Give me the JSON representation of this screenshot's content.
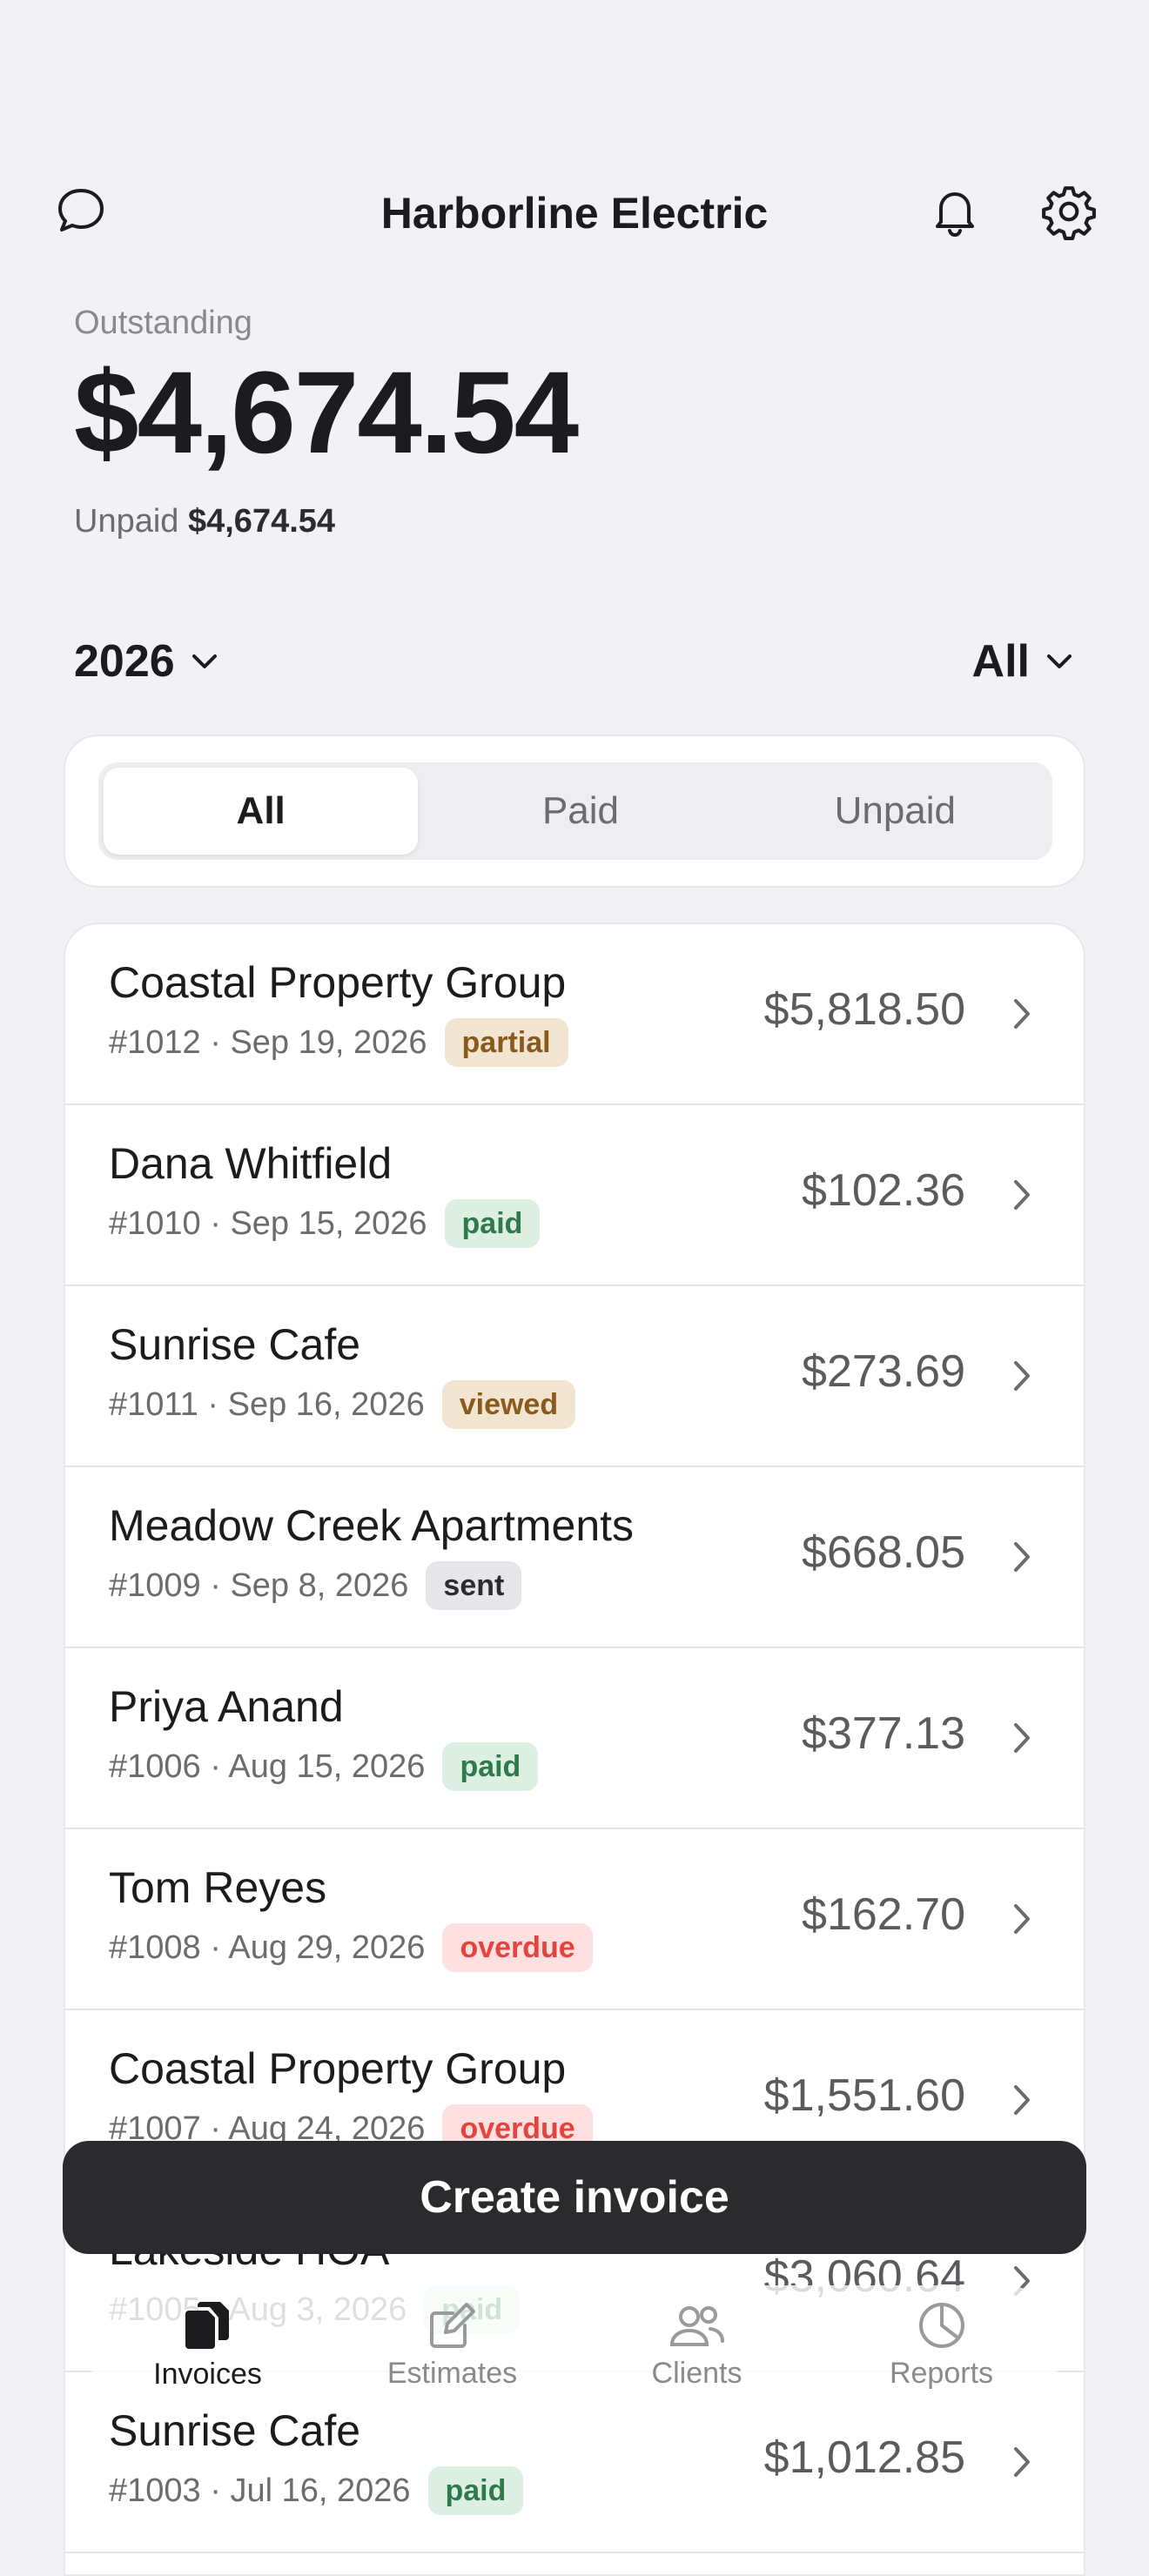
{
  "header": {
    "title": "Harborline Electric"
  },
  "summary": {
    "label": "Outstanding",
    "amount": "$4,674.54",
    "unpaid_label": "Unpaid",
    "unpaid_amount": "$4,674.54"
  },
  "filters": {
    "year": "2026",
    "status": "All"
  },
  "segments": [
    {
      "label": "All",
      "active": true
    },
    {
      "label": "Paid",
      "active": false
    },
    {
      "label": "Unpaid",
      "active": false
    }
  ],
  "invoices": [
    {
      "name": "Coastal Property Group",
      "meta": "#1012 · Sep 19, 2026",
      "status": "partial",
      "amount": "$5,818.50"
    },
    {
      "name": "Dana Whitfield",
      "meta": "#1010 · Sep 15, 2026",
      "status": "paid",
      "amount": "$102.36"
    },
    {
      "name": "Sunrise Cafe",
      "meta": "#1011 · Sep 16, 2026",
      "status": "viewed",
      "amount": "$273.69"
    },
    {
      "name": "Meadow Creek Apartments",
      "meta": "#1009 · Sep 8, 2026",
      "status": "sent",
      "amount": "$668.05"
    },
    {
      "name": "Priya Anand",
      "meta": "#1006 · Aug 15, 2026",
      "status": "paid",
      "amount": "$377.13"
    },
    {
      "name": "Tom Reyes",
      "meta": "#1008 · Aug 29, 2026",
      "status": "overdue",
      "amount": "$162.70"
    },
    {
      "name": "Coastal Property Group",
      "meta": "#1007 · Aug 24, 2026",
      "status": "overdue",
      "amount": "$1,551.60"
    },
    {
      "name": "Lakeside HOA",
      "meta": "#1005 · Aug 3, 2026",
      "status": "paid",
      "amount": "$3,060.64"
    },
    {
      "name": "Sunrise Cafe",
      "meta": "#1003 · Jul 16, 2026",
      "status": "paid",
      "amount": "$1,012.85"
    }
  ],
  "actions": {
    "create_label": "Create invoice"
  },
  "tabbar": [
    {
      "label": "Invoices",
      "icon": "documents-icon",
      "active": true
    },
    {
      "label": "Estimates",
      "icon": "edit-icon",
      "active": false
    },
    {
      "label": "Clients",
      "icon": "people-icon",
      "active": false
    },
    {
      "label": "Reports",
      "icon": "pie-chart-icon",
      "active": false
    }
  ]
}
